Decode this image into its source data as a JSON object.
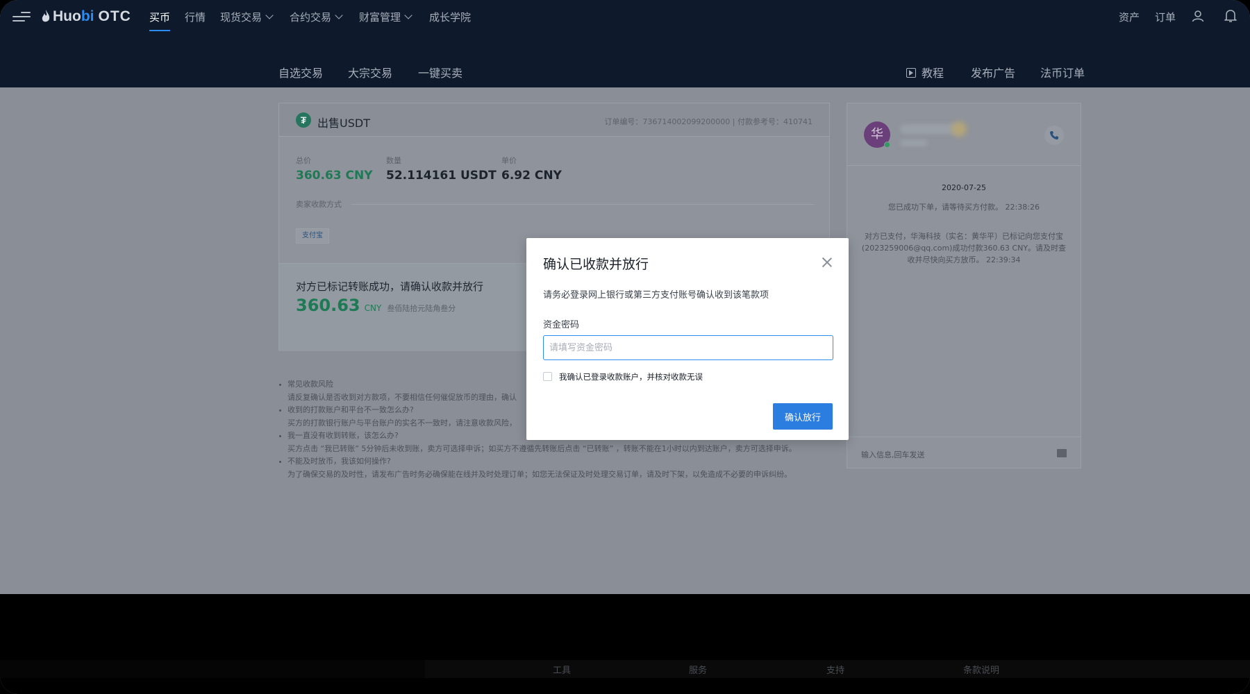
{
  "header": {
    "logo_prefix": "Huo",
    "logo_bi": "bi",
    "logo_suffix": "OTC",
    "nav": [
      {
        "label": "买币"
      },
      {
        "label": "行情"
      },
      {
        "label": "现货交易"
      },
      {
        "label": "合约交易"
      },
      {
        "label": "财富管理"
      },
      {
        "label": "成长学院"
      }
    ],
    "right": [
      {
        "label": "资产"
      },
      {
        "label": "订单"
      }
    ],
    "subnav": [
      {
        "label": "自选交易"
      },
      {
        "label": "大宗交易"
      },
      {
        "label": "一键买卖"
      }
    ],
    "subnav_right": [
      {
        "label": "教程"
      },
      {
        "label": "发布广告"
      },
      {
        "label": "法币订单"
      }
    ],
    "accent_color": "#2d8cf0"
  },
  "order": {
    "title": "出售USDT",
    "meta": "订单编号：736714002099200000   |   付款参考号：410741",
    "stats": [
      {
        "label": "总价",
        "value": "360.63 CNY"
      },
      {
        "label": "数量",
        "value": "52.114161 USDT"
      },
      {
        "label": "单价",
        "value": "6.92 CNY"
      }
    ],
    "payment_label": "卖家收款方式",
    "payment_method": "支付宝",
    "confirm_title": "对方已标记转账成功，请确认收款并放行",
    "confirm_amount": "360.63",
    "confirm_unit": "CNY",
    "confirm_words": "叁佰陆拾元陆角叁分"
  },
  "faq": [
    {
      "q": "常见收款风险",
      "a": "请反复确认是否收到对方款项，不要相信任何催促放币的理由，确认"
    },
    {
      "q": "收到的打款账户和平台不一致怎么办?",
      "a": "买方的打款银行账户与平台账户的实名不一致时，请注意收款风险，"
    },
    {
      "q": "我一直没有收到转账，该怎么办?",
      "a": "买方点击 “我已转账” 5分钟后未收到账，卖方可选择申诉；如买方不遵循先转账后点击 “已转账” ，转账不能在1小时以内到达账户，卖方可选择申诉。"
    },
    {
      "q": "不能及时放币，我该如何操作?",
      "a": "为了确保交易的及时性，请发布广告时务必确保能在线并及时处理订单；如您无法保证及时处理交易订单，请及时下架，以免造成不必要的申诉纠纷。"
    }
  ],
  "chat": {
    "avatar_char": "华",
    "date": "2020-07-25",
    "messages": [
      "您已成功下单，请等待买方付款。 22:38:26",
      "对方已支付，华海科技（实名：黄华平）已标记向您支付宝 (2023259006@qq.com)成功付款360.63 CNY。请及时查收并尽快向买方放币。 22:39:34"
    ],
    "input_placeholder": "输入信息,回车发送"
  },
  "modal": {
    "title": "确认已收款并放行",
    "description": "请务必登录网上银行或第三方支付账号确认收到该笔款项",
    "password_label": "资金密码",
    "password_placeholder": "请填写资金密码",
    "checkbox_label": "我确认已登录收款账户，并核对收款无误",
    "confirm_button": "确认放行"
  },
  "footer": {
    "items": [
      {
        "label": "工具"
      },
      {
        "label": "服务"
      },
      {
        "label": "支持"
      },
      {
        "label": "条款说明"
      }
    ]
  }
}
